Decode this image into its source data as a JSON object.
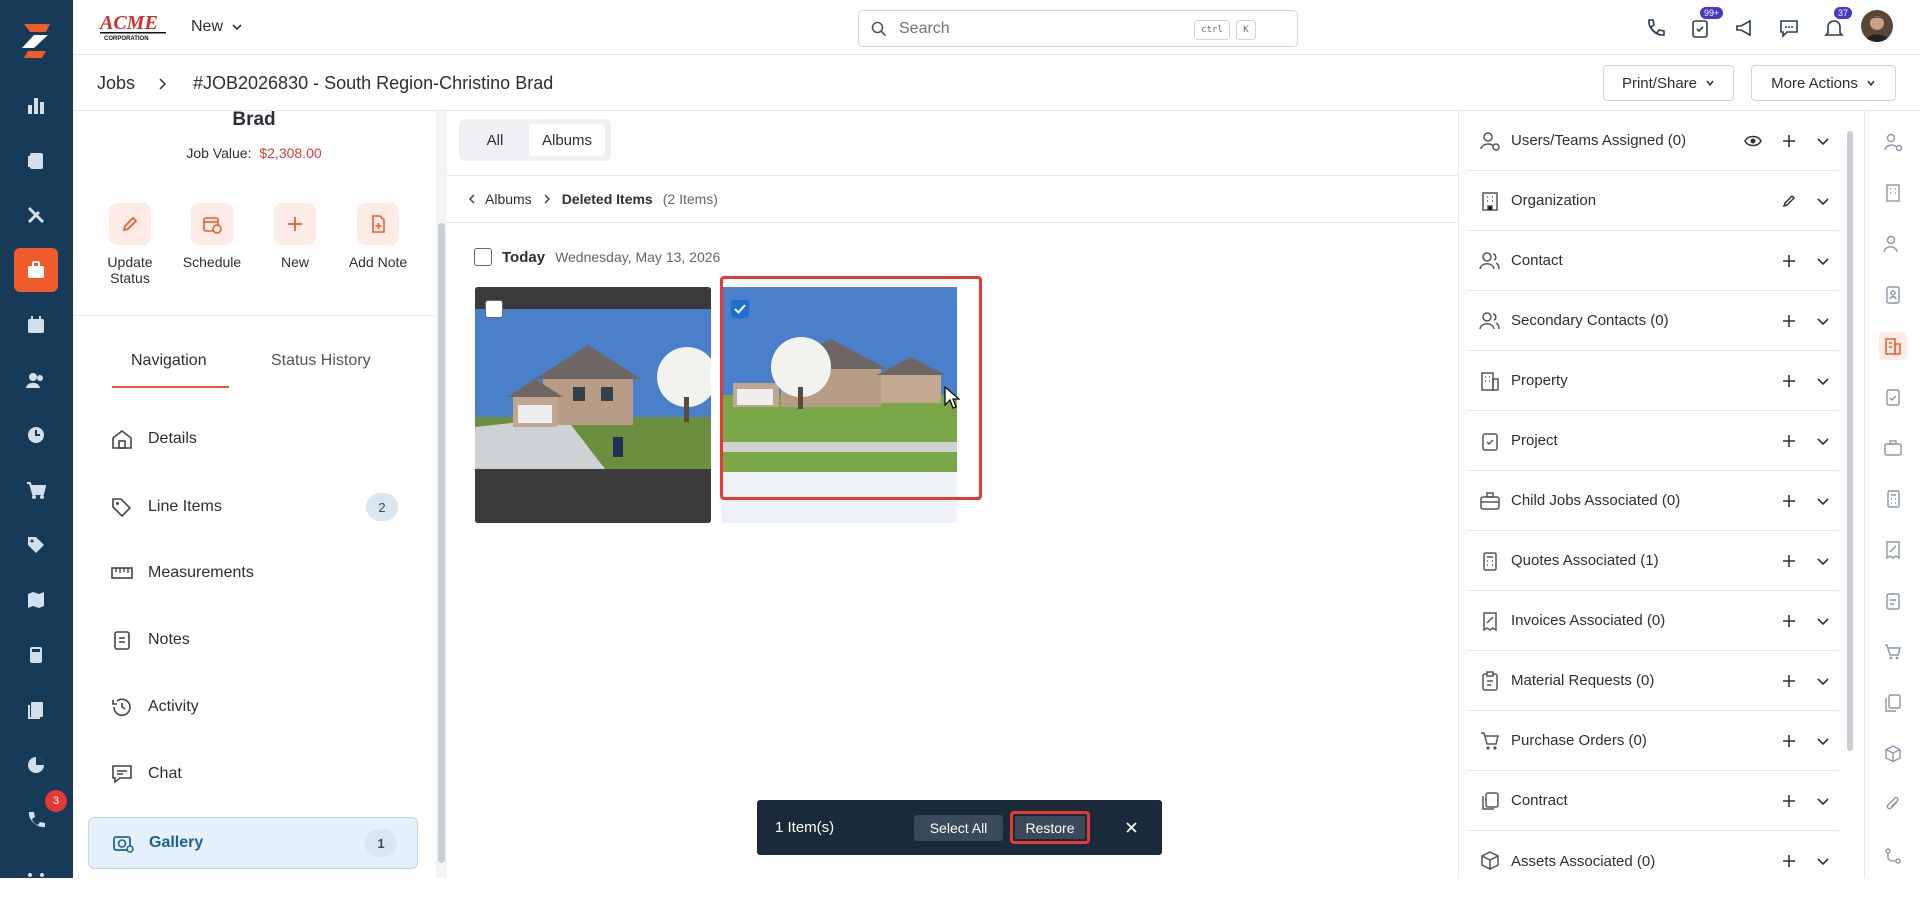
{
  "brand": {
    "name": "ACME CORPORATION"
  },
  "topbar": {
    "new_label": "New",
    "search_placeholder": "Search",
    "shortcut_ctrl": "ctrl",
    "shortcut_k": "K",
    "tasks_badge": "99+",
    "notifications_badge": "37"
  },
  "left_nav": {
    "chat_badge": "3"
  },
  "breadcrumb": {
    "section": "Jobs",
    "job_title": "#JOB2026830 - South Region-Christino Brad"
  },
  "header_actions": {
    "print_share": "Print/Share",
    "more_actions": "More Actions"
  },
  "job": {
    "name_tail": "Brad",
    "value_label": "Job Value:",
    "value": "$2,308.00"
  },
  "quick_actions": [
    {
      "label": "Update Status"
    },
    {
      "label": "Schedule"
    },
    {
      "label": "New"
    },
    {
      "label": "Add Note"
    }
  ],
  "left_tabs": {
    "navigation": "Navigation",
    "status_history": "Status History"
  },
  "nav_items": [
    {
      "label": "Details",
      "count": ""
    },
    {
      "label": "Line Items",
      "count": "2"
    },
    {
      "label": "Measurements",
      "count": ""
    },
    {
      "label": "Notes",
      "count": ""
    },
    {
      "label": "Activity",
      "count": ""
    },
    {
      "label": "Chat",
      "count": ""
    },
    {
      "label": "Gallery",
      "count": "1"
    }
  ],
  "gallery": {
    "tab_all": "All",
    "tab_albums": "Albums",
    "crumb_albums": "Albums",
    "crumb_current": "Deleted Items",
    "crumb_count": "(2 Items)",
    "group_label": "Today",
    "group_date": "Wednesday, May 13, 2026"
  },
  "selection_bar": {
    "count": "1 Item(s)",
    "select_all": "Select All",
    "restore": "Restore"
  },
  "right_sections": [
    {
      "label": "Users/Teams Assigned (0)",
      "icon": "user-gear-icon"
    },
    {
      "label": "Organization",
      "icon": "building-icon"
    },
    {
      "label": "Contact",
      "icon": "users-icon"
    },
    {
      "label": "Secondary Contacts (0)",
      "icon": "users-icon"
    },
    {
      "label": "Property",
      "icon": "building-icon"
    },
    {
      "label": "Project",
      "icon": "clipboard-check-icon"
    },
    {
      "label": "Child Jobs Associated (0)",
      "icon": "briefcase-icon"
    },
    {
      "label": "Quotes Associated (1)",
      "icon": "calculator-icon"
    },
    {
      "label": "Invoices Associated (0)",
      "icon": "invoice-icon"
    },
    {
      "label": "Material Requests (0)",
      "icon": "clipboard-icon"
    },
    {
      "label": "Purchase Orders (0)",
      "icon": "cart-icon"
    },
    {
      "label": "Contract",
      "icon": "copy-icon"
    },
    {
      "label": "Assets Associated (0)",
      "icon": "box-icon"
    }
  ],
  "colors": {
    "accent": "#ef5b2b",
    "nav_bg": "#163a57",
    "selection_bar": "#1b2a3a",
    "highlight_red": "#e53935"
  }
}
